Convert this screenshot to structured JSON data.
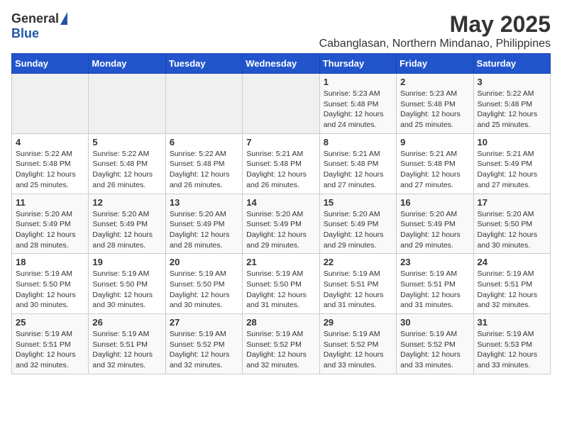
{
  "logo": {
    "general": "General",
    "blue": "Blue"
  },
  "title": "May 2025",
  "subtitle": "Cabanglasan, Northern Mindanao, Philippines",
  "days_of_week": [
    "Sunday",
    "Monday",
    "Tuesday",
    "Wednesday",
    "Thursday",
    "Friday",
    "Saturday"
  ],
  "weeks": [
    [
      {
        "day": "",
        "info": ""
      },
      {
        "day": "",
        "info": ""
      },
      {
        "day": "",
        "info": ""
      },
      {
        "day": "",
        "info": ""
      },
      {
        "day": "1",
        "info": "Sunrise: 5:23 AM\nSunset: 5:48 PM\nDaylight: 12 hours\nand 24 minutes."
      },
      {
        "day": "2",
        "info": "Sunrise: 5:23 AM\nSunset: 5:48 PM\nDaylight: 12 hours\nand 25 minutes."
      },
      {
        "day": "3",
        "info": "Sunrise: 5:22 AM\nSunset: 5:48 PM\nDaylight: 12 hours\nand 25 minutes."
      }
    ],
    [
      {
        "day": "4",
        "info": "Sunrise: 5:22 AM\nSunset: 5:48 PM\nDaylight: 12 hours\nand 25 minutes."
      },
      {
        "day": "5",
        "info": "Sunrise: 5:22 AM\nSunset: 5:48 PM\nDaylight: 12 hours\nand 26 minutes."
      },
      {
        "day": "6",
        "info": "Sunrise: 5:22 AM\nSunset: 5:48 PM\nDaylight: 12 hours\nand 26 minutes."
      },
      {
        "day": "7",
        "info": "Sunrise: 5:21 AM\nSunset: 5:48 PM\nDaylight: 12 hours\nand 26 minutes."
      },
      {
        "day": "8",
        "info": "Sunrise: 5:21 AM\nSunset: 5:48 PM\nDaylight: 12 hours\nand 27 minutes."
      },
      {
        "day": "9",
        "info": "Sunrise: 5:21 AM\nSunset: 5:48 PM\nDaylight: 12 hours\nand 27 minutes."
      },
      {
        "day": "10",
        "info": "Sunrise: 5:21 AM\nSunset: 5:49 PM\nDaylight: 12 hours\nand 27 minutes."
      }
    ],
    [
      {
        "day": "11",
        "info": "Sunrise: 5:20 AM\nSunset: 5:49 PM\nDaylight: 12 hours\nand 28 minutes."
      },
      {
        "day": "12",
        "info": "Sunrise: 5:20 AM\nSunset: 5:49 PM\nDaylight: 12 hours\nand 28 minutes."
      },
      {
        "day": "13",
        "info": "Sunrise: 5:20 AM\nSunset: 5:49 PM\nDaylight: 12 hours\nand 28 minutes."
      },
      {
        "day": "14",
        "info": "Sunrise: 5:20 AM\nSunset: 5:49 PM\nDaylight: 12 hours\nand 29 minutes."
      },
      {
        "day": "15",
        "info": "Sunrise: 5:20 AM\nSunset: 5:49 PM\nDaylight: 12 hours\nand 29 minutes."
      },
      {
        "day": "16",
        "info": "Sunrise: 5:20 AM\nSunset: 5:49 PM\nDaylight: 12 hours\nand 29 minutes."
      },
      {
        "day": "17",
        "info": "Sunrise: 5:20 AM\nSunset: 5:50 PM\nDaylight: 12 hours\nand 30 minutes."
      }
    ],
    [
      {
        "day": "18",
        "info": "Sunrise: 5:19 AM\nSunset: 5:50 PM\nDaylight: 12 hours\nand 30 minutes."
      },
      {
        "day": "19",
        "info": "Sunrise: 5:19 AM\nSunset: 5:50 PM\nDaylight: 12 hours\nand 30 minutes."
      },
      {
        "day": "20",
        "info": "Sunrise: 5:19 AM\nSunset: 5:50 PM\nDaylight: 12 hours\nand 30 minutes."
      },
      {
        "day": "21",
        "info": "Sunrise: 5:19 AM\nSunset: 5:50 PM\nDaylight: 12 hours\nand 31 minutes."
      },
      {
        "day": "22",
        "info": "Sunrise: 5:19 AM\nSunset: 5:51 PM\nDaylight: 12 hours\nand 31 minutes."
      },
      {
        "day": "23",
        "info": "Sunrise: 5:19 AM\nSunset: 5:51 PM\nDaylight: 12 hours\nand 31 minutes."
      },
      {
        "day": "24",
        "info": "Sunrise: 5:19 AM\nSunset: 5:51 PM\nDaylight: 12 hours\nand 32 minutes."
      }
    ],
    [
      {
        "day": "25",
        "info": "Sunrise: 5:19 AM\nSunset: 5:51 PM\nDaylight: 12 hours\nand 32 minutes."
      },
      {
        "day": "26",
        "info": "Sunrise: 5:19 AM\nSunset: 5:51 PM\nDaylight: 12 hours\nand 32 minutes."
      },
      {
        "day": "27",
        "info": "Sunrise: 5:19 AM\nSunset: 5:52 PM\nDaylight: 12 hours\nand 32 minutes."
      },
      {
        "day": "28",
        "info": "Sunrise: 5:19 AM\nSunset: 5:52 PM\nDaylight: 12 hours\nand 32 minutes."
      },
      {
        "day": "29",
        "info": "Sunrise: 5:19 AM\nSunset: 5:52 PM\nDaylight: 12 hours\nand 33 minutes."
      },
      {
        "day": "30",
        "info": "Sunrise: 5:19 AM\nSunset: 5:52 PM\nDaylight: 12 hours\nand 33 minutes."
      },
      {
        "day": "31",
        "info": "Sunrise: 5:19 AM\nSunset: 5:53 PM\nDaylight: 12 hours\nand 33 minutes."
      }
    ]
  ]
}
